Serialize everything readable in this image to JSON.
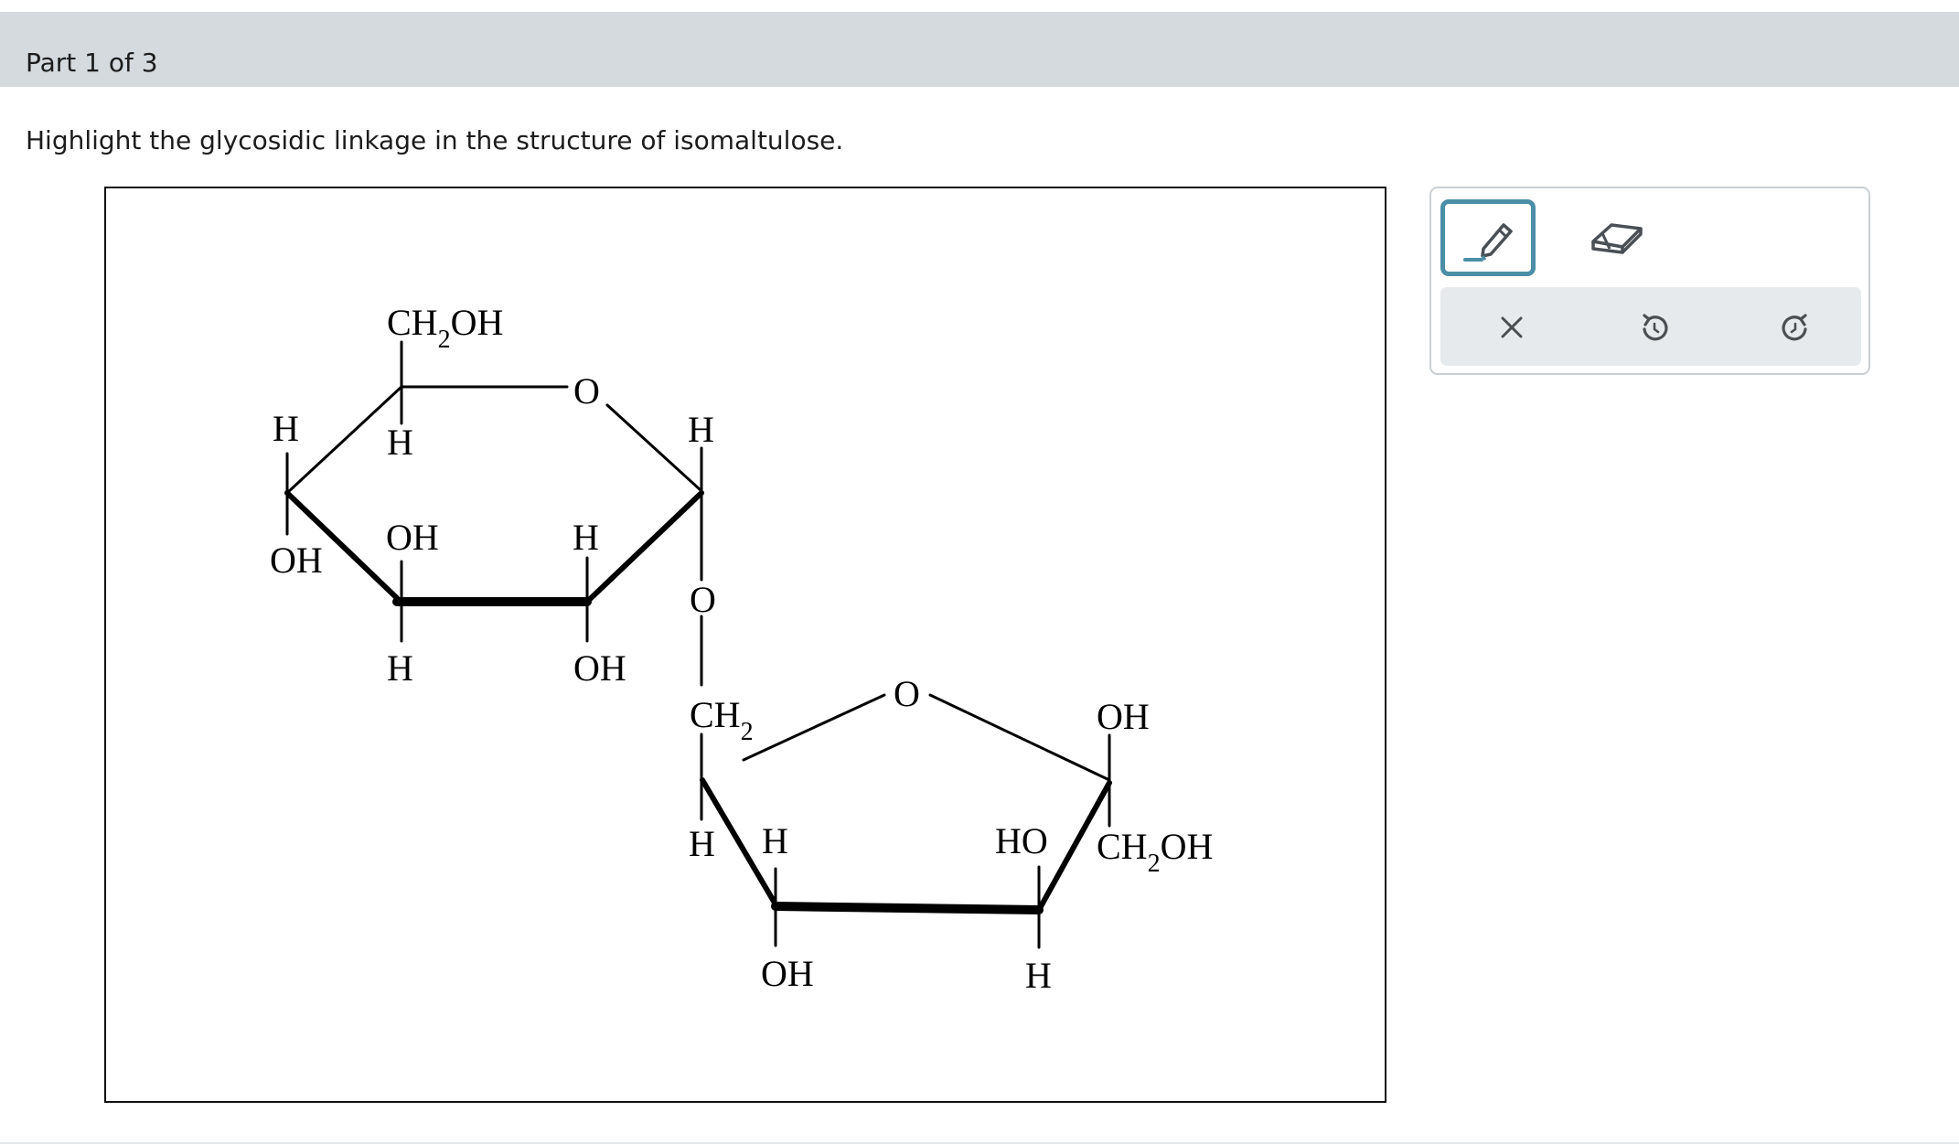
{
  "part_header": {
    "label": "Part 1 of 3"
  },
  "question": {
    "prompt": "Highlight the glycosidic linkage in the structure of isomaltulose."
  },
  "structure": {
    "glucose_ring": {
      "top_substituent_main": "CH",
      "top_substituent_sub": "2",
      "top_substituent_end": "OH",
      "ring_oxygen": "O",
      "c4_top": "H",
      "c4_bottom": "OH",
      "c5_bottom": "H",
      "c3_top": "OH",
      "c3_bottom": "H",
      "c2_top": "H",
      "c2_bottom": "OH",
      "c1_top": "H"
    },
    "linkage": {
      "oxygen": "O",
      "ch2_main": "CH",
      "ch2_sub": "2"
    },
    "fructose_ring": {
      "ring_oxygen": "O",
      "c5_bottom": "H",
      "c4_top": "H",
      "c4_bottom": "OH",
      "c3_top": "HO",
      "c3_bottom": "H",
      "c2_top": "OH",
      "c2_bottom_main": "CH",
      "c2_bottom_sub": "2",
      "c2_bottom_end": "OH"
    }
  },
  "toolbar": {
    "tools": [
      {
        "name": "highlighter",
        "icon": "highlighter-icon",
        "selected": true
      },
      {
        "name": "eraser",
        "icon": "eraser-icon",
        "selected": false
      }
    ],
    "actions": [
      {
        "name": "clear",
        "icon": "close-icon"
      },
      {
        "name": "undo",
        "icon": "undo-icon"
      },
      {
        "name": "redo",
        "icon": "redo-icon"
      }
    ],
    "accent_color": "#4c8ea6",
    "icon_color": "#4a4f54"
  }
}
